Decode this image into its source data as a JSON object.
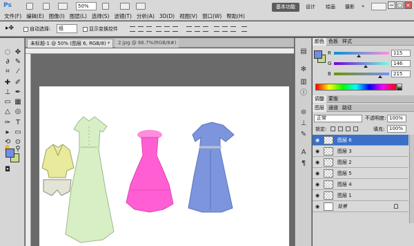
{
  "titlebar": {
    "logo": "Ps",
    "zoom": "50%",
    "workspace_active": "基本功能",
    "workspace_links": [
      "设计",
      "绘画",
      "摄影"
    ],
    "more": "»"
  },
  "menu": [
    "文件(F)",
    "编辑(E)",
    "图像(I)",
    "图层(L)",
    "选择(S)",
    "滤镜(T)",
    "分析(A)",
    "3D(D)",
    "视图(V)",
    "窗口(W)",
    "帮助(H)"
  ],
  "options": {
    "auto_select_label": "自动选择:",
    "auto_select_target": "组",
    "show_transform_label": "显示变换控件"
  },
  "tabs": {
    "active": "未标题-1 @ 50% (图层 6, RGB/8) *",
    "inactive": "2.jpg @ 66.7%(RGB/8#)"
  },
  "colors": {
    "foreground": "#6f8fe6",
    "background": "#c4de86"
  },
  "color_panel": {
    "tabs": [
      "颜色",
      "色板",
      "样式"
    ],
    "r_label": "R",
    "g_label": "G",
    "b_label": "B",
    "r": "115",
    "g": "146",
    "b": "215"
  },
  "adjust_tabs": [
    "调整",
    "蒙版"
  ],
  "layers_tabs": [
    "图层",
    "通道",
    "路径"
  ],
  "layers_panel": {
    "blend_mode": "正常",
    "opacity_label": "不透明度:",
    "opacity": "100%",
    "lock_label": "锁定:",
    "fill_label": "填充:",
    "fill": "100%",
    "layers": [
      {
        "name": "图层 6",
        "active": true
      },
      {
        "name": "图层 3",
        "active": false
      },
      {
        "name": "图层 2",
        "active": false
      },
      {
        "name": "图层 5",
        "active": false
      },
      {
        "name": "图层 4",
        "active": false
      },
      {
        "name": "图层 1",
        "active": false
      },
      {
        "name": "背景",
        "active": false,
        "background": true
      }
    ]
  }
}
